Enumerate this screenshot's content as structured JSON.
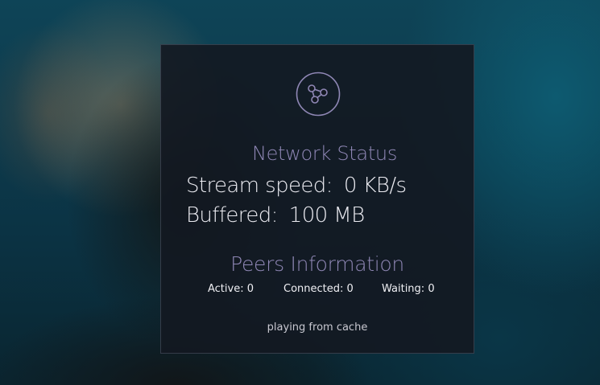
{
  "network": {
    "icon": "network-share-icon",
    "title": "Network Status",
    "stream_speed_label": "Stream speed:",
    "stream_speed_value": "0 KB/s",
    "buffered_label": "Buffered:",
    "buffered_value": "100 MB"
  },
  "peers": {
    "title": "Peers Information",
    "active": "Active: 0",
    "connected": "Connected: 0",
    "waiting": "Waiting: 0"
  },
  "status_text": "playing from cache",
  "colors": {
    "accent": "#8f87b5",
    "panel": "#131821"
  }
}
